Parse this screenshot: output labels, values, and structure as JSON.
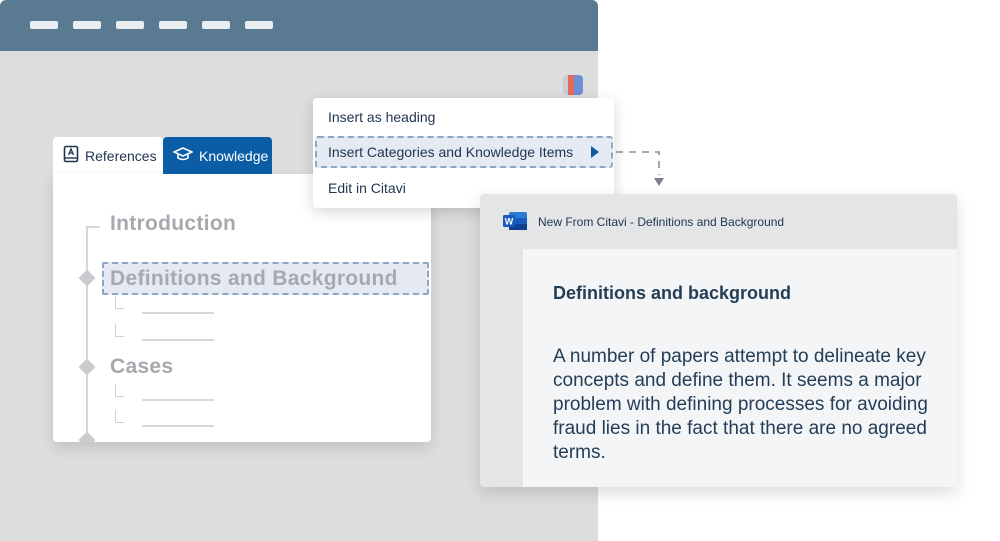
{
  "tabs": {
    "references": "References",
    "knowledge": "Knowledge"
  },
  "tree": {
    "items": [
      "Introduction",
      "Definitions and Background",
      "Cases"
    ]
  },
  "context_menu": {
    "items": [
      "Insert as heading",
      "Insert Categories and Knowledge Items",
      "Edit in Citavi"
    ]
  },
  "word_window": {
    "title": "New From Citavi - Definitions and Background",
    "heading": "Definitions and background",
    "body": "A number of papers attempt to delineate key concepts and define them. It seems a major problem with defining processes for avoiding fraud lies in the fact that there are no agreed terms."
  },
  "icons": {
    "references_tab": "book-icon",
    "knowledge_tab": "graduation-cap-icon",
    "submenu": "chevron-right-icon",
    "word": "word-icon",
    "citavi": "citavi-icon"
  },
  "colors": {
    "accent": "#0b5ea6",
    "titlebar": "#5a7a91",
    "highlight_border": "#8ea6c6"
  }
}
